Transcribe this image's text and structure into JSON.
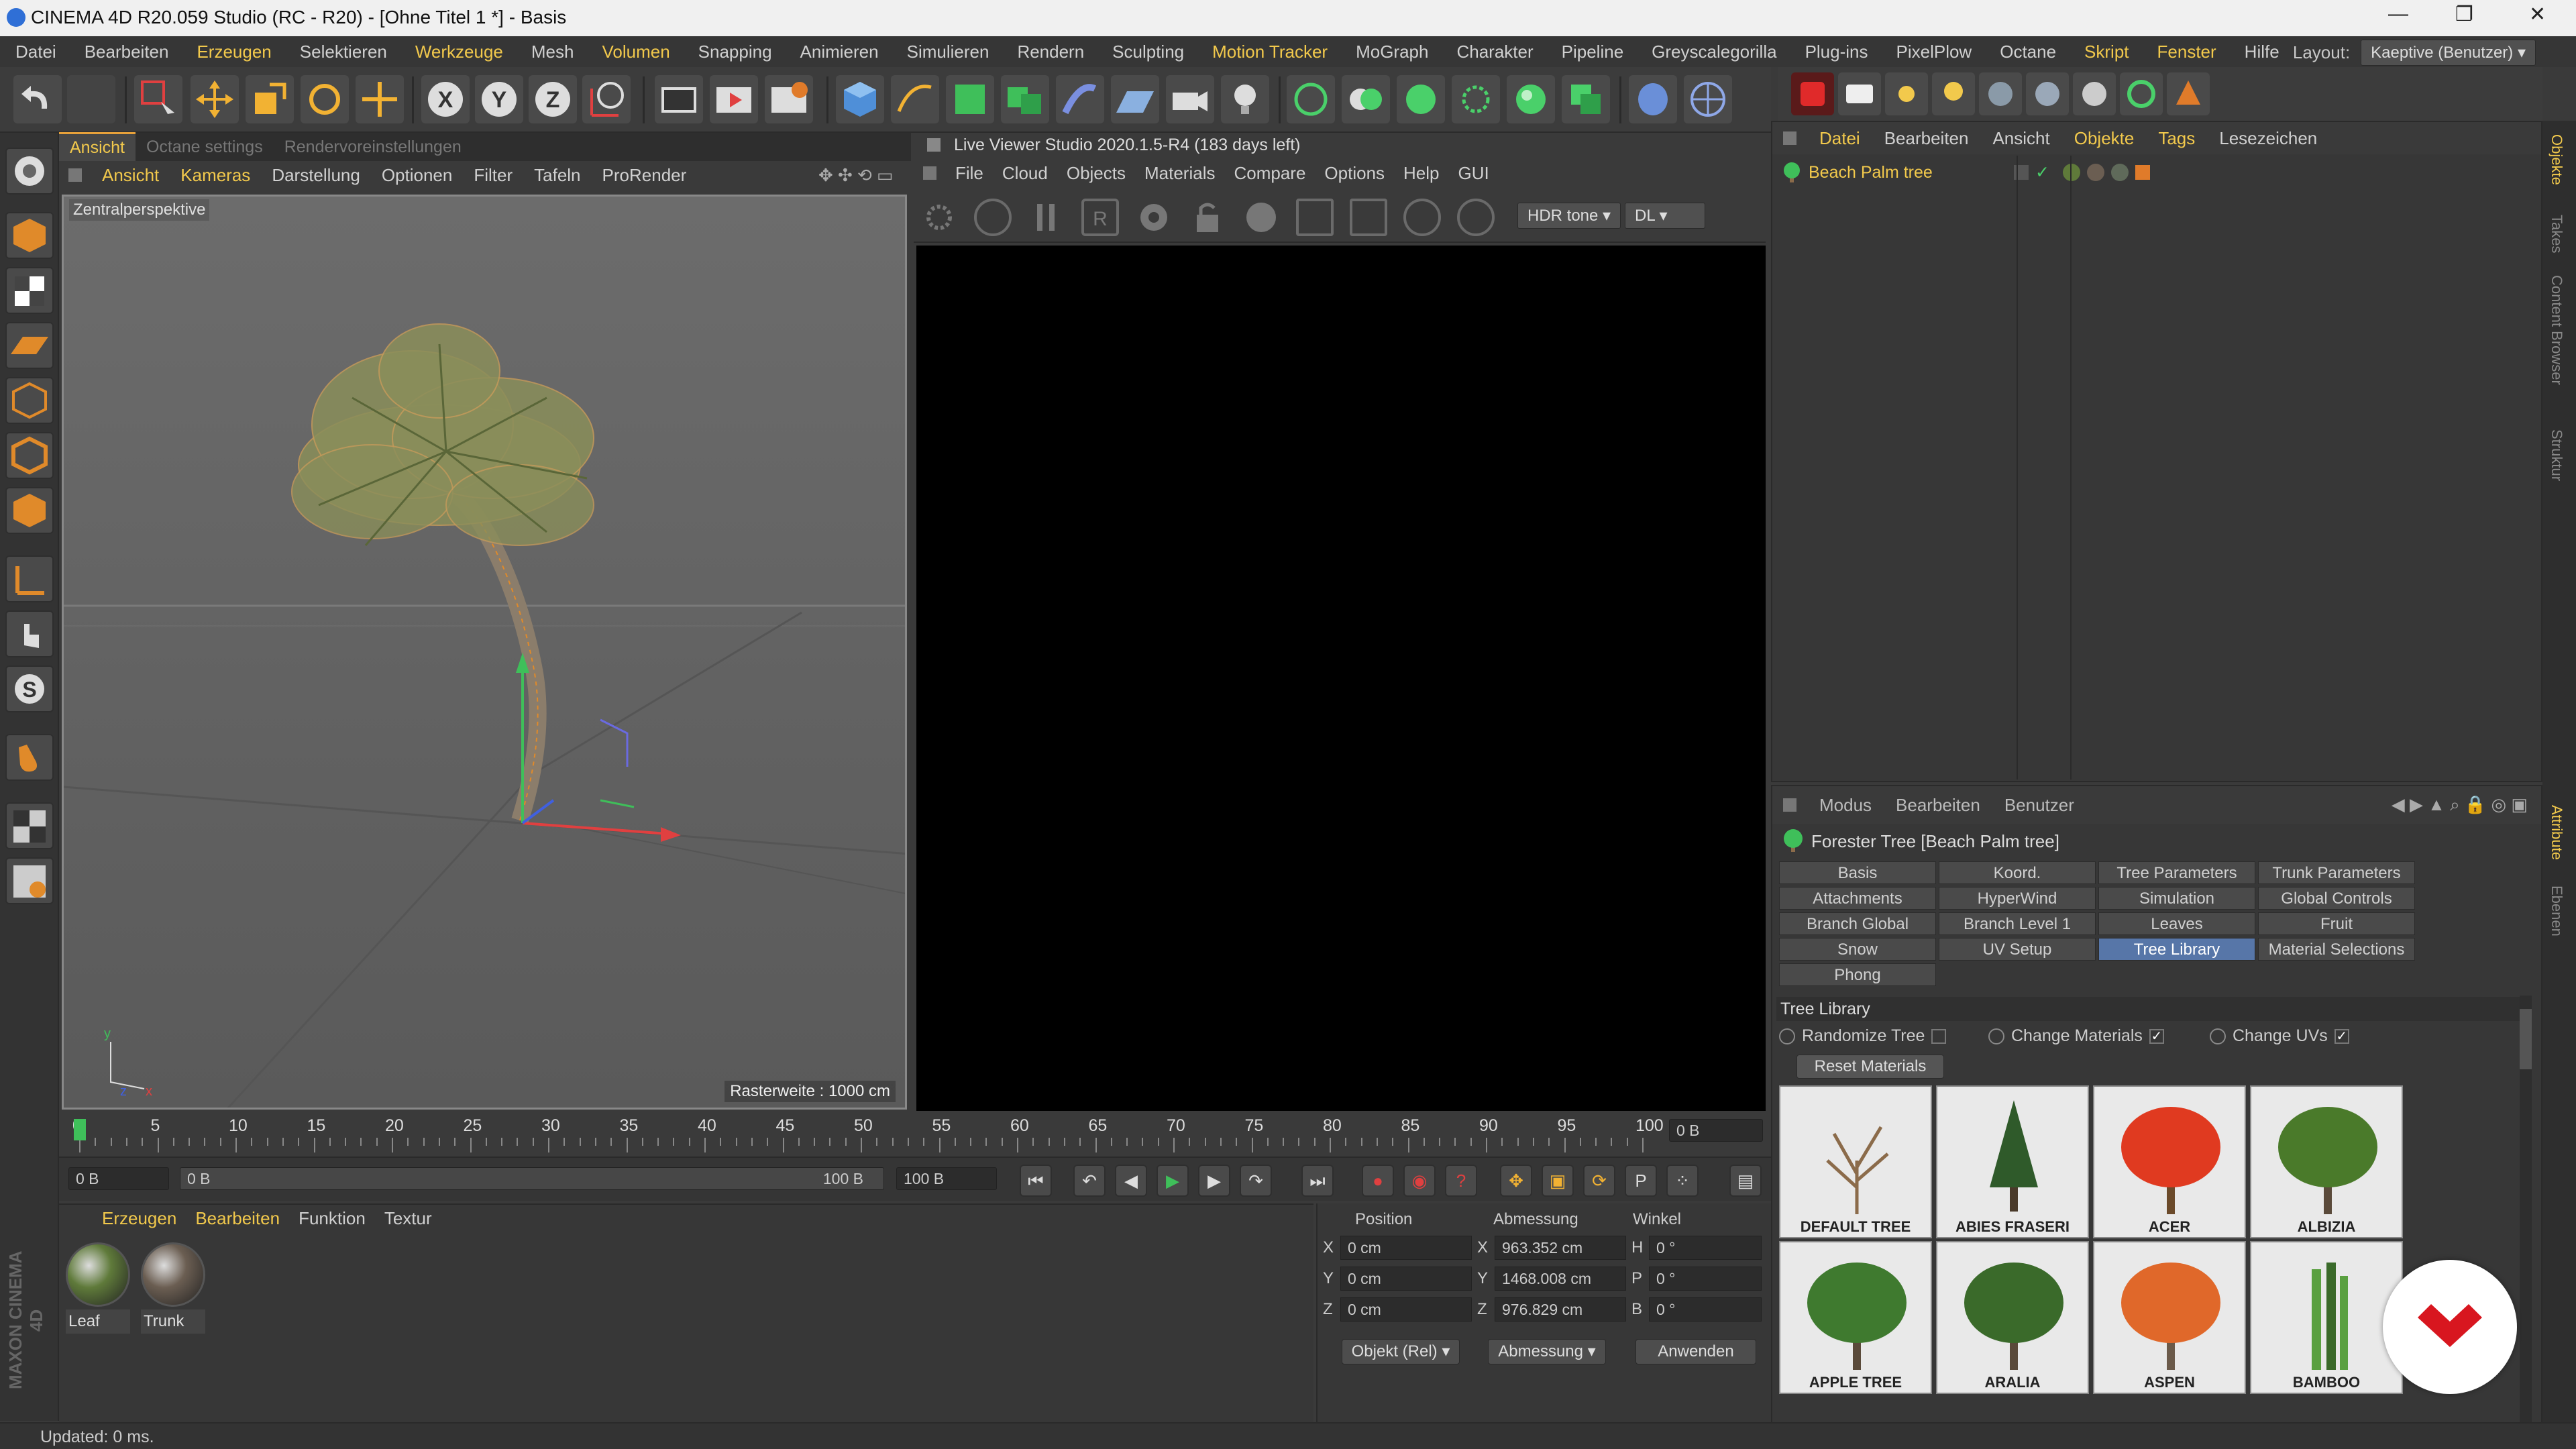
{
  "window": {
    "title": "CINEMA 4D R20.059 Studio (RC - R20) - [Ohne Titel 1 *] - Basis",
    "minimize": "—",
    "restore": "❐",
    "close": "✕"
  },
  "menubar": {
    "items": [
      "Datei",
      "Bearbeiten",
      "Erzeugen",
      "Selektieren",
      "Werkzeuge",
      "Mesh",
      "Volumen",
      "Snapping",
      "Animieren",
      "Simulieren",
      "Rendern",
      "Sculpting",
      "Motion Tracker",
      "MoGraph",
      "Charakter",
      "Pipeline",
      "Greyscalegorilla",
      "Plug-ins",
      "PixelPlow",
      "Octane",
      "Skript",
      "Fenster",
      "Hilfe"
    ],
    "highlighted": [
      "Erzeugen",
      "Werkzeuge",
      "Volumen",
      "Motion Tracker",
      "Skript",
      "Fenster"
    ],
    "layout_label": "Layout:",
    "layout_value": "Kaeptive (Benutzer)"
  },
  "viewport": {
    "tabs": [
      "Ansicht",
      "Octane settings",
      "Rendervoreinstellungen"
    ],
    "active_tab": "Ansicht",
    "menu": [
      "Ansicht",
      "Kameras",
      "Darstellung",
      "Optionen",
      "Filter",
      "Tafeln",
      "ProRender"
    ],
    "menu_highlighted": [
      "Ansicht",
      "Kameras"
    ],
    "camera_label": "Zentralperspektive",
    "raster": "Rasterweite : 1000 cm"
  },
  "live_viewer": {
    "title": "Live Viewer Studio 2020.1.5-R4 (183 days left)",
    "menu": [
      "File",
      "Cloud",
      "Objects",
      "Materials",
      "Compare",
      "Options",
      "Help",
      "GUI"
    ],
    "tonemap": "HDR tone",
    "mode": "DL"
  },
  "object_manager": {
    "menu": [
      "Datei",
      "Bearbeiten",
      "Ansicht",
      "Objekte",
      "Tags",
      "Lesezeichen"
    ],
    "menu_highlighted": [
      "Datei",
      "Objekte",
      "Tags"
    ],
    "object_name": "Beach Palm tree"
  },
  "attribute_manager": {
    "menu": [
      "Modus",
      "Bearbeiten",
      "Benutzer"
    ],
    "object_title": "Forester Tree [Beach Palm tree]",
    "tabs": [
      "Basis",
      "Koord.",
      "Tree Parameters",
      "Trunk Parameters",
      "Attachments",
      "HyperWind",
      "Simulation",
      "Global Controls",
      "Branch Global",
      "Branch Level 1",
      "Leaves",
      "Fruit",
      "Snow",
      "UV Setup",
      "Tree Library",
      "Material Selections",
      "Phong"
    ],
    "active_tab": "Tree Library",
    "section": "Tree Library",
    "options": [
      {
        "label": "Randomize Tree",
        "checked": false,
        "check_mark": ""
      },
      {
        "label": "Change Materials",
        "checked": true,
        "check_mark": "✓"
      },
      {
        "label": "Change UVs",
        "checked": true,
        "check_mark": "✓"
      }
    ],
    "reset_button": "Reset Materials",
    "trees": [
      "DEFAULT TREE",
      "ABIES FRASERI",
      "ACER",
      "ALBIZIA",
      "APPLE TREE",
      "ARALIA",
      "ASPEN",
      "BAMBOO"
    ]
  },
  "right_tabs": [
    "Objekte",
    "Takes",
    "Content Browser",
    "Struktur",
    "Attribute",
    "Ebenen"
  ],
  "timeline": {
    "ticks": [
      "0",
      "5",
      "10",
      "15",
      "20",
      "25",
      "30",
      "35",
      "40",
      "45",
      "50",
      "55",
      "60",
      "65",
      "70",
      "75",
      "80",
      "85",
      "90",
      "95",
      "100"
    ],
    "current_frame": "0 B",
    "start": "0 B",
    "range_start": "0 B",
    "range_end": "100 B",
    "end": "100 B"
  },
  "material_manager": {
    "menu": [
      "Erzeugen",
      "Bearbeiten",
      "Funktion",
      "Textur"
    ],
    "menu_highlighted": [
      "Erzeugen",
      "Bearbeiten"
    ],
    "materials": [
      {
        "name": "Leaf",
        "color": "#5f7a3a"
      },
      {
        "name": "Trunk",
        "color": "#6b5e52"
      }
    ]
  },
  "coordinates": {
    "headers": [
      "Position",
      "Abmessung",
      "Winkel"
    ],
    "rows": [
      {
        "axis": "X",
        "pos": "0 cm",
        "size_axis": "X",
        "size": "963.352 cm",
        "rot_axis": "H",
        "rot": "0 °"
      },
      {
        "axis": "Y",
        "pos": "0 cm",
        "size_axis": "Y",
        "size": "1468.008 cm",
        "rot_axis": "P",
        "rot": "0 °"
      },
      {
        "axis": "Z",
        "pos": "0 cm",
        "size_axis": "Z",
        "size": "976.829 cm",
        "rot_axis": "B",
        "rot": "0 °"
      }
    ],
    "mode_select": "Objekt (Rel)",
    "size_select": "Abmessung",
    "apply": "Anwenden"
  },
  "status": "Updated: 0 ms.",
  "maxon": "MAXON CINEMA 4D",
  "colors": {
    "accent": "#f2c94c",
    "active_tab": "#5776a8",
    "badge": "#d8161f"
  }
}
